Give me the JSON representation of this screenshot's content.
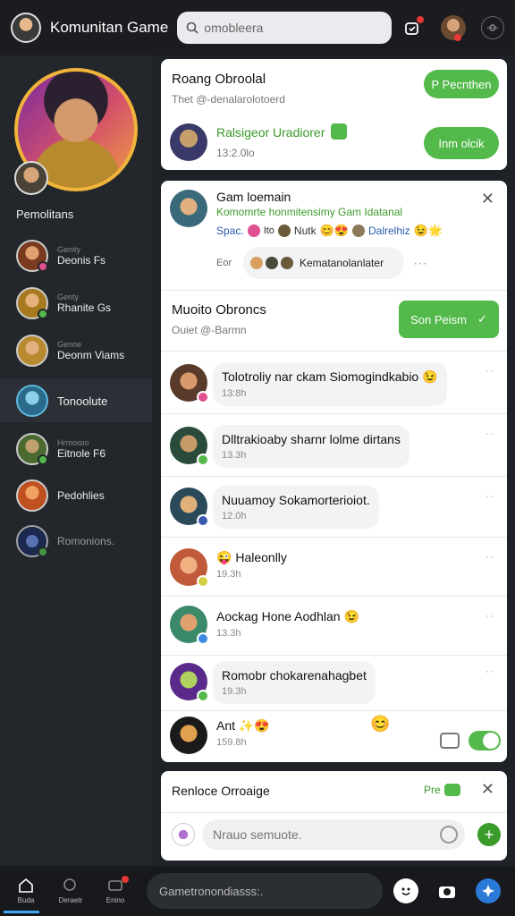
{
  "header": {
    "title": "Komunitan Game",
    "search_placeholder": "omobleera"
  },
  "sidebar": {
    "section_title": "Pemolitans",
    "items": [
      {
        "sub": "Genity",
        "name": "Deonis Fs"
      },
      {
        "sub": "Genty",
        "name": "Rhanite Gs"
      },
      {
        "sub": "Genne",
        "name": "Deonm Viams"
      },
      {
        "sub": "",
        "name": "Tonoolute"
      },
      {
        "sub": "Hrmoisio",
        "name": "Eitnole F6"
      },
      {
        "sub": "",
        "name": "Pedohlies"
      },
      {
        "sub": "",
        "name": "Romonions."
      }
    ]
  },
  "card_top": {
    "title": "Roang Obroolal",
    "subtitle": "Thet @-denalarolotoerd",
    "btn1": "P Pecnthen",
    "user_name": "Ralsigeor Uradiorer",
    "user_time": "13:2.0lo",
    "btn2": "Inm olcik"
  },
  "card_chat": {
    "header_name": "Gam loemain",
    "header_desc": "Komomrte honmitensimy Gam Idatanal",
    "header_line": "Spac.",
    "header_line2": "Nutk",
    "header_line3": "Dalrelhiz",
    "reaction_prefix": "Eor",
    "reaction_label": "Kematanolanlater",
    "section_title": "Muoito Obroncs",
    "section_sub": "Ouiet @-Barmn",
    "section_btn": "Son Peism",
    "messages": [
      {
        "text": "Tolotroliy nar ckam Siomogindkabio",
        "time": "13:8h"
      },
      {
        "text": "Dlltrakioaby sharnr lolme dirtans",
        "time": "13.3h"
      },
      {
        "text": "Nuuamoy Sokamorterioiot.",
        "time": "12.0h"
      },
      {
        "text": "Haleonlly",
        "time": "19.3h"
      },
      {
        "text": "Aockag Hone Aodhlan",
        "time": "13.3h"
      },
      {
        "text": "Romobr chokarenahagbet",
        "time": "19.3h"
      },
      {
        "text": "Ant",
        "time": "159.8h"
      }
    ]
  },
  "composer": {
    "title": "Renloce Orroaige",
    "badge": "Pre",
    "placeholder": "Nrauo semuote."
  },
  "bottom_nav": {
    "items": [
      "Buda",
      "Deraetr",
      "Enino"
    ],
    "search_placeholder": "Gametronondiasss:."
  },
  "colors": {
    "accent_green": "#52b94a",
    "accent_blue": "#3fa9f5"
  }
}
